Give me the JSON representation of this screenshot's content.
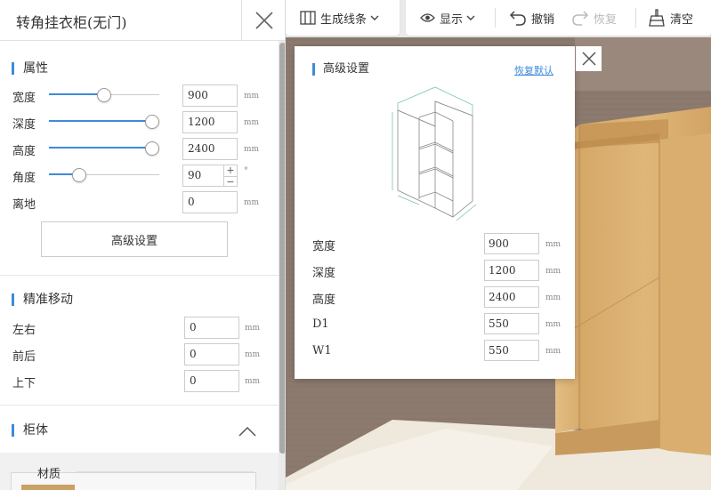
{
  "panel": {
    "title": "转角挂衣柜(无门)",
    "properties_title": "属性",
    "rows": [
      {
        "label": "宽度",
        "value": "900",
        "unit": "mm",
        "slider_fraction": 0.5
      },
      {
        "label": "深度",
        "value": "1200",
        "unit": "mm",
        "slider_fraction": 1.0
      },
      {
        "label": "高度",
        "value": "2400",
        "unit": "mm",
        "slider_fraction": 1.0
      },
      {
        "label": "角度",
        "value": "90",
        "unit": "°",
        "slider_fraction": 0.25
      },
      {
        "label": "离地",
        "value": "0",
        "unit": "mm"
      }
    ],
    "stepper": {
      "plus": "+",
      "minus": "−"
    },
    "advanced_button": "高级设置",
    "precise_title": "精准移动",
    "precise_rows": [
      {
        "label": "左右",
        "value": "0",
        "unit": "mm"
      },
      {
        "label": "前后",
        "value": "0",
        "unit": "mm"
      },
      {
        "label": "上下",
        "value": "0",
        "unit": "mm"
      }
    ],
    "cabinet_title": "柜体",
    "material_label": "材质"
  },
  "toolbar": {
    "generate_lines": "生成线条",
    "display": "显示",
    "undo": "撤销",
    "redo": "恢复",
    "clear": "清空"
  },
  "advanced": {
    "title": "高级设置",
    "reset": "恢复默认",
    "rows": [
      {
        "label": "宽度",
        "value": "900",
        "unit": "mm"
      },
      {
        "label": "深度",
        "value": "1200",
        "unit": "mm"
      },
      {
        "label": "高度",
        "value": "2400",
        "unit": "mm"
      },
      {
        "label": "D1",
        "value": "550",
        "unit": "mm"
      },
      {
        "label": "W1",
        "value": "550",
        "unit": "mm"
      }
    ]
  },
  "colors": {
    "accent": "#3d8bd9",
    "wall": "#8c7a6e",
    "wood": "#d9b073",
    "floor": "#efe8dc"
  }
}
